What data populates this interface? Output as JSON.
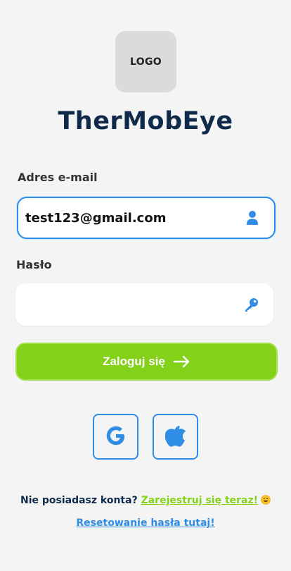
{
  "logo": {
    "label": "LOGO"
  },
  "app": {
    "title": "TherMobEye"
  },
  "form": {
    "email_label": "Adres e-mail",
    "email_value": "test123@gmail.com",
    "email_icon": "user-icon",
    "password_label": "Hasło",
    "password_value": "",
    "password_icon": "key-icon",
    "submit_label": "Zaloguj się",
    "submit_icon": "arrow-right-icon"
  },
  "social": {
    "google_icon": "google-icon",
    "apple_icon": "apple-icon"
  },
  "footer": {
    "no_account_text": "Nie posiadasz konta?",
    "register_link": "Zarejestruj się teraz!",
    "reset_link": "Resetowanie hasła tutaj!"
  },
  "colors": {
    "background": "#f4f4f4",
    "title": "#0f2a4a",
    "accent_blue": "#2f8de6",
    "accent_green": "#84d11a",
    "logo_box": "#dbdbdb"
  }
}
